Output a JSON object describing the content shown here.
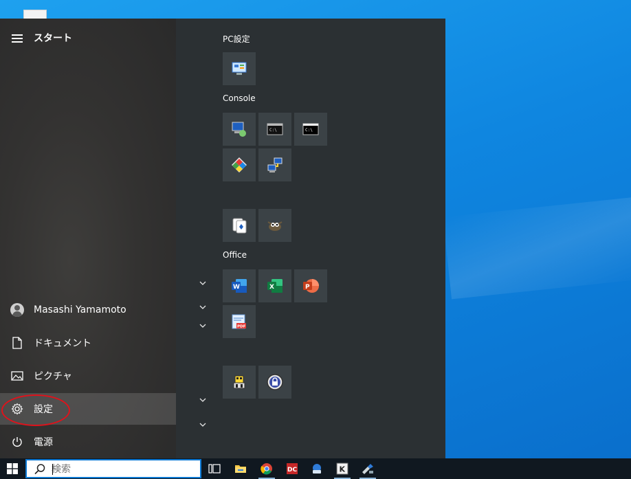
{
  "start_menu": {
    "title": "スタート",
    "left_items": [
      {
        "label": "Masashi Yamamoto",
        "icon": "user-avatar-icon"
      },
      {
        "label": "ドキュメント",
        "icon": "document-icon"
      },
      {
        "label": "ピクチャ",
        "icon": "picture-icon"
      },
      {
        "label": "設定",
        "icon": "gear-icon"
      },
      {
        "label": "電源",
        "icon": "power-icon"
      }
    ],
    "groups": [
      {
        "label": "PC設定"
      },
      {
        "label": "Console"
      },
      {
        "label": "Office"
      }
    ],
    "tiles": {
      "pc_settings": "control-panel-icon",
      "console": [
        "remote-desktop-icon",
        "command-prompt-icon",
        "terminal-icon",
        "diamond-tool-icon",
        "network-computer-icon"
      ],
      "misc": [
        "solitaire-icon",
        "gimp-icon"
      ],
      "office": [
        "word-icon",
        "excel-icon",
        "powerpoint-icon",
        "pdf-editor-icon"
      ],
      "bottom": [
        "transformer-icon",
        "keepass-lock-icon"
      ]
    }
  },
  "taskbar": {
    "search_placeholder": "検索",
    "icons": [
      "task-view-icon",
      "file-explorer-icon",
      "chrome-icon",
      "app-dc-icon",
      "app-blue-icon",
      "app-k-icon",
      "app-tool-icon"
    ]
  },
  "colors": {
    "accent": "#0a78d4",
    "highlight": "#e0121b",
    "tile_bg": "#3b4246"
  }
}
